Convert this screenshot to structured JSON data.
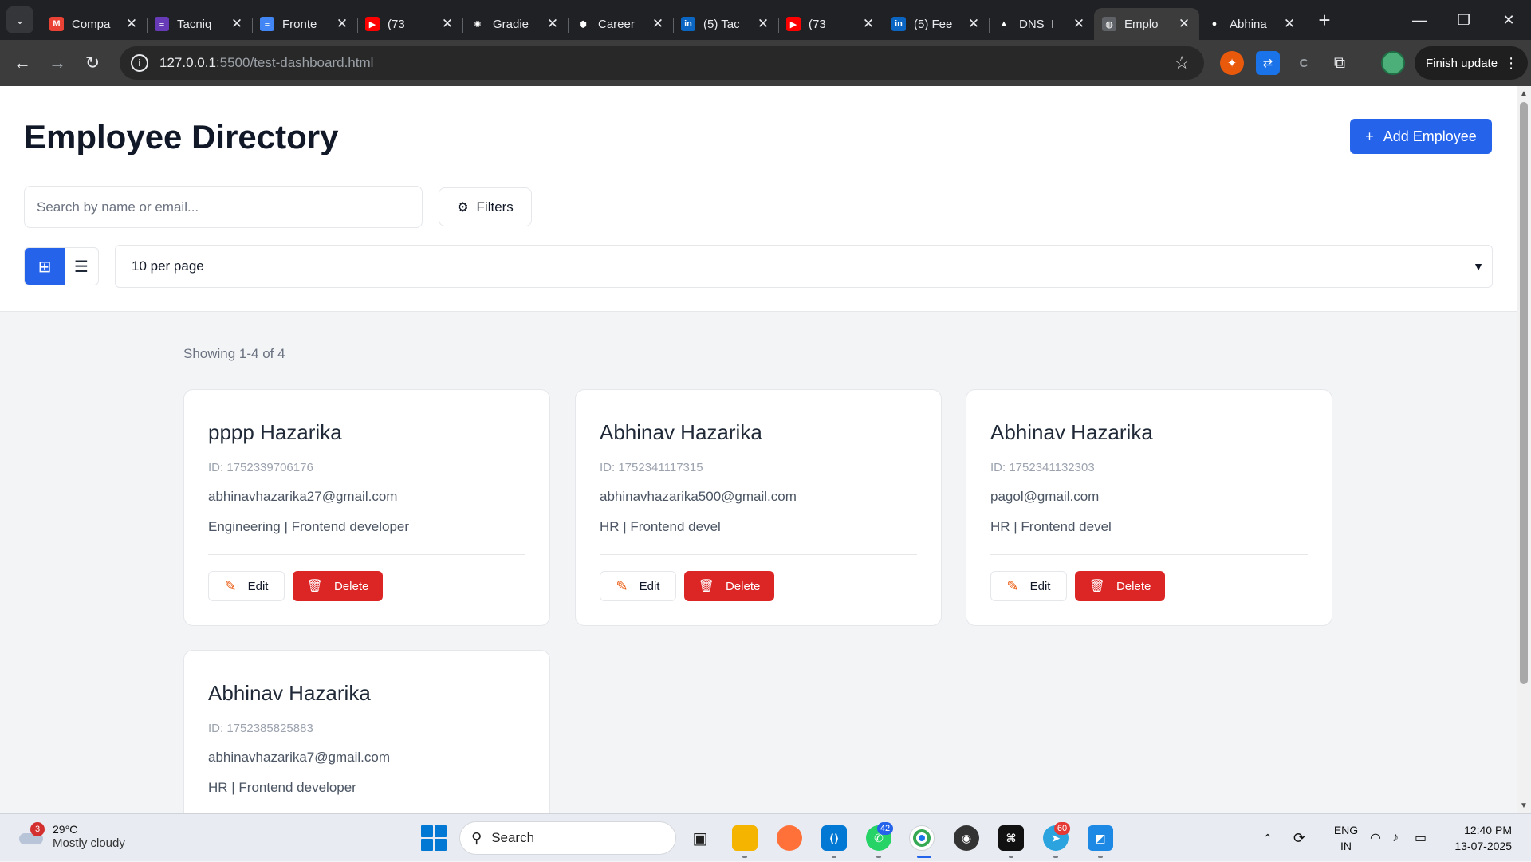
{
  "browser": {
    "tabs": [
      {
        "title": "Compa",
        "icon": "gmail-icon",
        "color": "#ea4335",
        "glyph": "M"
      },
      {
        "title": "Tacniq",
        "icon": "forms-icon",
        "color": "#673ab7",
        "glyph": "≡"
      },
      {
        "title": "Fronte",
        "icon": "docs-icon",
        "color": "#4285f4",
        "glyph": "≡"
      },
      {
        "title": "(73",
        "icon": "youtube-icon",
        "color": "#ff0000",
        "glyph": "▶"
      },
      {
        "title": "Gradie",
        "icon": "openai-icon",
        "color": "#202124",
        "glyph": "✺"
      },
      {
        "title": "Career",
        "icon": "shield-icon",
        "color": "#202124",
        "glyph": "⬢"
      },
      {
        "title": "(5) Tac",
        "icon": "linkedin-icon",
        "color": "#0a66c2",
        "glyph": "in"
      },
      {
        "title": "(73",
        "icon": "youtube-icon",
        "color": "#ff0000",
        "glyph": "▶"
      },
      {
        "title": "(5) Fee",
        "icon": "linkedin-icon",
        "color": "#0a66c2",
        "glyph": "in"
      },
      {
        "title": "DNS_I",
        "icon": "vercel-icon",
        "color": "#202124",
        "glyph": "▲"
      },
      {
        "title": "Emplo",
        "icon": "globe-icon",
        "color": "#5f6368",
        "glyph": "◍"
      },
      {
        "title": "Abhina",
        "icon": "github-icon",
        "color": "#202124",
        "glyph": "●"
      }
    ],
    "url_host": "127.0.0.1",
    "url_path": ":5500/test-dashboard.html",
    "finish_update_label": "Finish update"
  },
  "page": {
    "title": "Employee Directory",
    "add_button_label": "Add Employee",
    "search_placeholder": "Search by name or email...",
    "filters_label": "Filters",
    "per_page_selected": "10 per page",
    "showing_text": "Showing 1-4 of 4",
    "edit_label": "Edit",
    "delete_label": "Delete",
    "employees": [
      {
        "name": "pppp Hazarika",
        "id": "ID: 1752339706176",
        "email": "abhinavhazarika27@gmail.com",
        "dept": "Engineering | Frontend developer"
      },
      {
        "name": "Abhinav Hazarika",
        "id": "ID: 1752341117315",
        "email": "abhinavhazarika500@gmail.com",
        "dept": "HR | Frontend devel"
      },
      {
        "name": "Abhinav Hazarika",
        "id": "ID: 1752341132303",
        "email": "pagol@gmail.com",
        "dept": "HR | Frontend devel"
      },
      {
        "name": "Abhinav Hazarika",
        "id": "ID: 1752385825883",
        "email": "abhinavhazarika7@gmail.com",
        "dept": "HR | Frontend developer"
      }
    ]
  },
  "taskbar": {
    "weather_badge": "3",
    "temperature": "29°C",
    "condition": "Mostly cloudy",
    "search_label": "Search",
    "whatsapp_badge": "42",
    "telegram_badge": "60",
    "lang_line1": "ENG",
    "lang_line2": "IN",
    "time": "12:40 PM",
    "date": "13-07-2025"
  },
  "colors": {
    "accent": "#2563eb",
    "danger": "#dc2626"
  }
}
